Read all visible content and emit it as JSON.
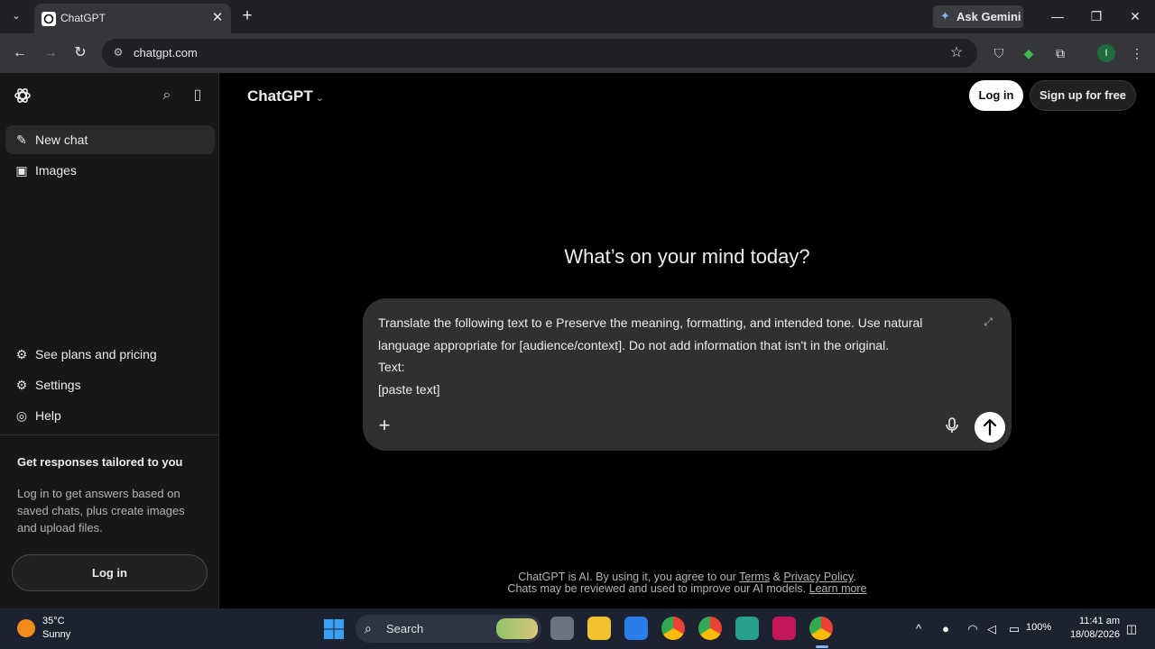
{
  "browser": {
    "tab_title": "ChatGPT",
    "url": "chatgpt.com",
    "gemini_label": "Ask Gemini",
    "profile_initial": "I"
  },
  "sidebar": {
    "items": [
      {
        "label": "New chat",
        "icon": "edit-icon"
      },
      {
        "label": "Images",
        "icon": "images-icon"
      }
    ],
    "bottom_items": [
      {
        "label": "See plans and pricing",
        "icon": "plans-icon"
      },
      {
        "label": "Settings",
        "icon": "gear-icon"
      },
      {
        "label": "Help",
        "icon": "help-icon"
      }
    ],
    "promo_title": "Get responses tailored to you",
    "promo_body": "Log in to get answers based on saved chats, plus create images and upload files.",
    "login_label": "Log in"
  },
  "header": {
    "model": "ChatGPT",
    "login_label": "Log in",
    "signup_label": "Sign up for free"
  },
  "main": {
    "heading": "What’s on your mind today?",
    "prompt": "Translate the following text to e Preserve the meaning, formatting, and intended tone. Use natural language appropriate for [audience/context]. Do not add information that isn't in the original.\nText:\n[paste text]",
    "footer_prefix": "ChatGPT is AI. By using it, you agree to our ",
    "footer_terms": "Terms",
    "footer_amp": " & ",
    "footer_privacy": "Privacy Policy",
    "footer_period": ".",
    "footer_line2_prefix": "Chats may be reviewed and used to improve our AI models. ",
    "footer_learn": "Learn more"
  },
  "taskbar": {
    "temperature": "35°C",
    "condition": "Sunny",
    "search_label": "Search",
    "battery_pct": "100%",
    "time": "11:41 am",
    "date": "18/08/2026"
  }
}
